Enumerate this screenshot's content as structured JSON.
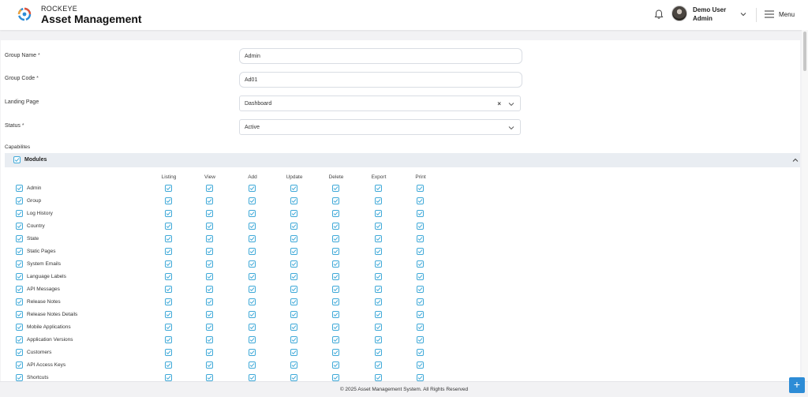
{
  "header": {
    "brand_small": "ROCKEYE",
    "brand_big": "Asset Management",
    "user_name": "Demo User",
    "user_role": "Admin",
    "menu_label": "Menu"
  },
  "form": {
    "group_name": {
      "label": "Group Name",
      "required": "*",
      "value": "Admin"
    },
    "group_code": {
      "label": "Group Code",
      "required": "*",
      "value": "Ad01"
    },
    "landing_page": {
      "label": "Landing Page",
      "value": "Dashboard",
      "clear": "×"
    },
    "status": {
      "label": "Status",
      "required": "*",
      "value": "Active"
    }
  },
  "capabilities": {
    "label": "Capabilites",
    "modules_label": "Modules",
    "columns": [
      "Listing",
      "View",
      "Add",
      "Update",
      "Delete",
      "Export",
      "Print"
    ],
    "rows": [
      "Admin",
      "Group",
      "Log History",
      "Country",
      "State",
      "Static Pages",
      "System Emails",
      "Language Labels",
      "API Messages",
      "Release Notes",
      "Release Notes Details",
      "Mobile Applications",
      "Application Versions",
      "Customers",
      "API Access Keys",
      "Shortcuts"
    ]
  },
  "footer": {
    "text": "© 2025 Asset Management System. All Rights Reserved"
  },
  "fab": {
    "label": "+"
  },
  "colors": {
    "accent": "#2d8cd6",
    "checkbox": "#3fa9d8"
  }
}
